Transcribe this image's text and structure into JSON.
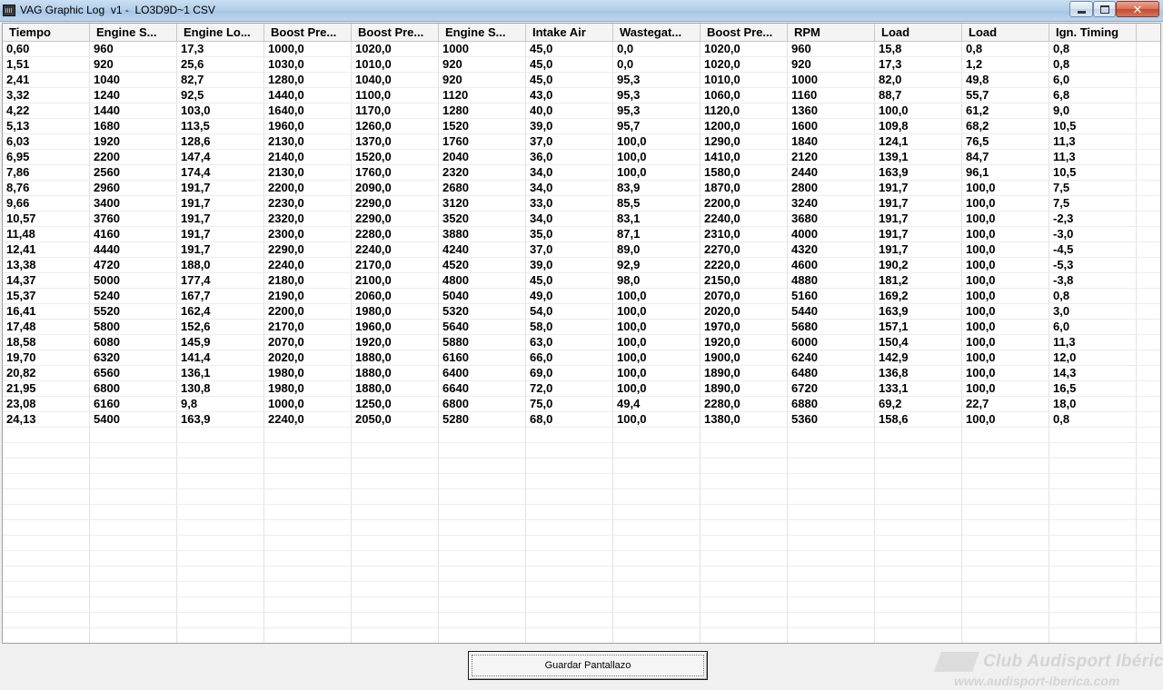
{
  "window": {
    "title": "VAG Graphic Log  v1 -  LO3D9D~1 CSV",
    "icon": "app-icon",
    "controls": {
      "minimize": "minimize",
      "maximize": "maximize",
      "close": "✕"
    }
  },
  "table": {
    "columns": [
      "Tiempo",
      "Engine S...",
      "Engine Lo...",
      "Boost Pre...",
      "Boost Pre...",
      "Engine S...",
      "Intake Air",
      "Wastegat...",
      "Boost Pre...",
      "RPM",
      "Load",
      "Load",
      "Ign. Timing"
    ],
    "rows": [
      [
        "0,60",
        "960",
        "17,3",
        "1000,0",
        "1020,0",
        "1000",
        "45,0",
        "0,0",
        "1020,0",
        "960",
        "15,8",
        "0,8",
        "0,8"
      ],
      [
        "1,51",
        "920",
        "25,6",
        "1030,0",
        "1010,0",
        "920",
        "45,0",
        "0,0",
        "1020,0",
        "920",
        "17,3",
        "1,2",
        "0,8"
      ],
      [
        "2,41",
        "1040",
        "82,7",
        "1280,0",
        "1040,0",
        "920",
        "45,0",
        "95,3",
        "1010,0",
        "1000",
        "82,0",
        "49,8",
        "6,0"
      ],
      [
        "3,32",
        "1240",
        "92,5",
        "1440,0",
        "1100,0",
        "1120",
        "43,0",
        "95,3",
        "1060,0",
        "1160",
        "88,7",
        "55,7",
        "6,8"
      ],
      [
        "4,22",
        "1440",
        "103,0",
        "1640,0",
        "1170,0",
        "1280",
        "40,0",
        "95,3",
        "1120,0",
        "1360",
        "100,0",
        "61,2",
        "9,0"
      ],
      [
        "5,13",
        "1680",
        "113,5",
        "1960,0",
        "1260,0",
        "1520",
        "39,0",
        "95,7",
        "1200,0",
        "1600",
        "109,8",
        "68,2",
        "10,5"
      ],
      [
        "6,03",
        "1920",
        "128,6",
        "2130,0",
        "1370,0",
        "1760",
        "37,0",
        "100,0",
        "1290,0",
        "1840",
        "124,1",
        "76,5",
        "11,3"
      ],
      [
        "6,95",
        "2200",
        "147,4",
        "2140,0",
        "1520,0",
        "2040",
        "36,0",
        "100,0",
        "1410,0",
        "2120",
        "139,1",
        "84,7",
        "11,3"
      ],
      [
        "7,86",
        "2560",
        "174,4",
        "2130,0",
        "1760,0",
        "2320",
        "34,0",
        "100,0",
        "1580,0",
        "2440",
        "163,9",
        "96,1",
        "10,5"
      ],
      [
        "8,76",
        "2960",
        "191,7",
        "2200,0",
        "2090,0",
        "2680",
        "34,0",
        "83,9",
        "1870,0",
        "2800",
        "191,7",
        "100,0",
        "7,5"
      ],
      [
        "9,66",
        "3400",
        "191,7",
        "2230,0",
        "2290,0",
        "3120",
        "33,0",
        "85,5",
        "2200,0",
        "3240",
        "191,7",
        "100,0",
        "7,5"
      ],
      [
        "10,57",
        "3760",
        "191,7",
        "2320,0",
        "2290,0",
        "3520",
        "34,0",
        "83,1",
        "2240,0",
        "3680",
        "191,7",
        "100,0",
        "-2,3"
      ],
      [
        "11,48",
        "4160",
        "191,7",
        "2300,0",
        "2280,0",
        "3880",
        "35,0",
        "87,1",
        "2310,0",
        "4000",
        "191,7",
        "100,0",
        "-3,0"
      ],
      [
        "12,41",
        "4440",
        "191,7",
        "2290,0",
        "2240,0",
        "4240",
        "37,0",
        "89,0",
        "2270,0",
        "4320",
        "191,7",
        "100,0",
        "-4,5"
      ],
      [
        "13,38",
        "4720",
        "188,0",
        "2240,0",
        "2170,0",
        "4520",
        "39,0",
        "92,9",
        "2220,0",
        "4600",
        "190,2",
        "100,0",
        "-5,3"
      ],
      [
        "14,37",
        "5000",
        "177,4",
        "2180,0",
        "2100,0",
        "4800",
        "45,0",
        "98,0",
        "2150,0",
        "4880",
        "181,2",
        "100,0",
        "-3,8"
      ],
      [
        "15,37",
        "5240",
        "167,7",
        "2190,0",
        "2060,0",
        "5040",
        "49,0",
        "100,0",
        "2070,0",
        "5160",
        "169,2",
        "100,0",
        "0,8"
      ],
      [
        "16,41",
        "5520",
        "162,4",
        "2200,0",
        "1980,0",
        "5320",
        "54,0",
        "100,0",
        "2020,0",
        "5440",
        "163,9",
        "100,0",
        "3,0"
      ],
      [
        "17,48",
        "5800",
        "152,6",
        "2170,0",
        "1960,0",
        "5640",
        "58,0",
        "100,0",
        "1970,0",
        "5680",
        "157,1",
        "100,0",
        "6,0"
      ],
      [
        "18,58",
        "6080",
        "145,9",
        "2070,0",
        "1920,0",
        "5880",
        "63,0",
        "100,0",
        "1920,0",
        "6000",
        "150,4",
        "100,0",
        "11,3"
      ],
      [
        "19,70",
        "6320",
        "141,4",
        "2020,0",
        "1880,0",
        "6160",
        "66,0",
        "100,0",
        "1900,0",
        "6240",
        "142,9",
        "100,0",
        "12,0"
      ],
      [
        "20,82",
        "6560",
        "136,1",
        "1980,0",
        "1880,0",
        "6400",
        "69,0",
        "100,0",
        "1890,0",
        "6480",
        "136,8",
        "100,0",
        "14,3"
      ],
      [
        "21,95",
        "6800",
        "130,8",
        "1980,0",
        "1880,0",
        "6640",
        "72,0",
        "100,0",
        "1890,0",
        "6720",
        "133,1",
        "100,0",
        "16,5"
      ],
      [
        "23,08",
        "6160",
        "9,8",
        "1000,0",
        "1250,0",
        "6800",
        "75,0",
        "49,4",
        "2280,0",
        "6880",
        "69,2",
        "22,7",
        "18,0"
      ],
      [
        "24,13",
        "5400",
        "163,9",
        "2240,0",
        "2050,0",
        "5280",
        "68,0",
        "100,0",
        "1380,0",
        "5360",
        "158,6",
        "100,0",
        "0,8"
      ]
    ]
  },
  "footer": {
    "save_button": "Guardar Pantallazo",
    "watermark_title": "Club Audisport Ibérica",
    "watermark_url": "www.audisport-iberica.com"
  }
}
